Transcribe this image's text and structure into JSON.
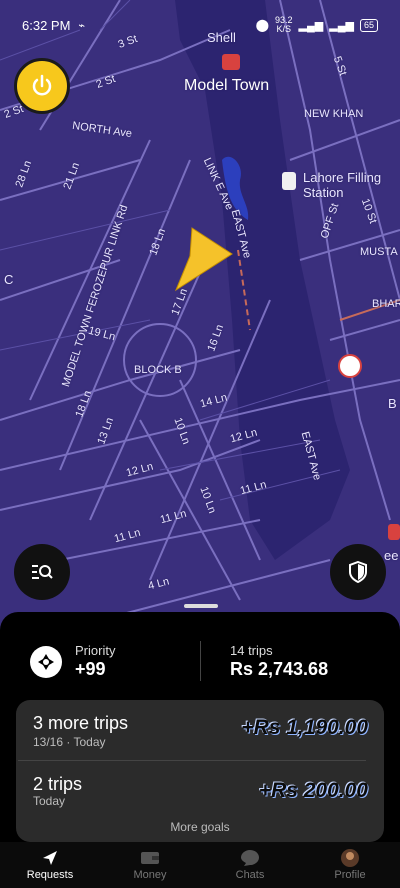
{
  "status": {
    "time": "6:32 PM",
    "speed": "93.2",
    "speed_unit": "K/S",
    "battery": "65"
  },
  "map": {
    "labels": {
      "shell": "Shell",
      "model_town": "Model Town",
      "new_khan": "NEW KHAN",
      "lahore_filling": "Lahore Filling",
      "station": "Station",
      "north_ave": "NORTH Ave",
      "link_e_ave": "LINK E Ave",
      "east_ave_top": "EAST Ave",
      "east_ave_bottom": "EAST Ave",
      "ferozepur": "MODEL TOWN FEROZEPUR LINK Rd",
      "block_b": "BLOCK B",
      "mustafa": "MUSTA",
      "bhar": "BHAR",
      "opf": "OPF St",
      "st5": "5 St",
      "st10": "10 St",
      "st3": "3 St",
      "st2": "2 St",
      "st4": "4 St",
      "ln28": "28 Ln",
      "ln21": "21 Ln",
      "ln18": "18 Ln",
      "ln17": "17 Ln",
      "ln16": "16 Ln",
      "ln14": "14 Ln",
      "ln13": "13 Ln",
      "ln12a": "12 Ln",
      "ln12b": "12 Ln",
      "ln11a": "11 Ln",
      "ln11b": "11 Ln",
      "ln11c": "11 Ln",
      "ln10a": "10 Ln",
      "ln10b": "10 Ln",
      "ln19": "19 Ln",
      "ln18b": "18 Ln",
      "ln4": "4 Ln",
      "st_c": "C",
      "b": "B",
      "eee": "ee"
    }
  },
  "stats": {
    "priority_label": "Priority",
    "priority_value": "+99",
    "trips_label": "14 trips",
    "trips_value": "Rs 2,743.68"
  },
  "goals": [
    {
      "title": "3 more trips",
      "sub": "13/16 · Today",
      "amount": "+Rs 1,190.00"
    },
    {
      "title": "2 trips",
      "sub": "Today",
      "amount": "+Rs 200.00"
    }
  ],
  "more_goals": "More goals",
  "nav": [
    {
      "label": "Requests",
      "icon": "navigation-arrow-icon"
    },
    {
      "label": "Money",
      "icon": "wallet-icon"
    },
    {
      "label": "Chats",
      "icon": "chat-bubble-icon"
    },
    {
      "label": "Profile",
      "icon": "avatar"
    }
  ],
  "colors": {
    "map_bg": "#3a2f7d",
    "accent_yellow": "#f7c81c",
    "sheet_bg": "#000000",
    "card_bg": "#2b2b2b"
  }
}
